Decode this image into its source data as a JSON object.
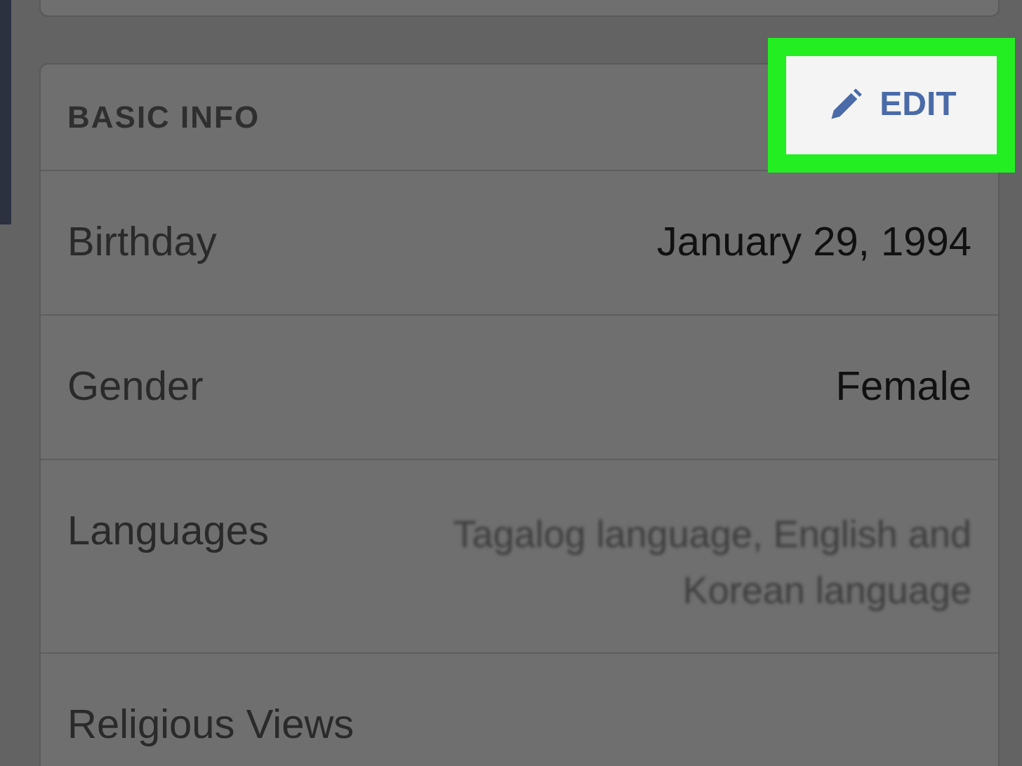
{
  "section": {
    "title": "BASIC INFO",
    "edit_button": {
      "label": "EDIT",
      "highlighted": true
    }
  },
  "rows": [
    {
      "label": "Birthday",
      "value": "January 29, 1994",
      "blurred": false
    },
    {
      "label": "Gender",
      "value": "Female",
      "blurred": false
    },
    {
      "label": "Languages",
      "value": "Tagalog language, English and Korean language",
      "blurred": true
    },
    {
      "label": "Religious Views"
    }
  ]
}
